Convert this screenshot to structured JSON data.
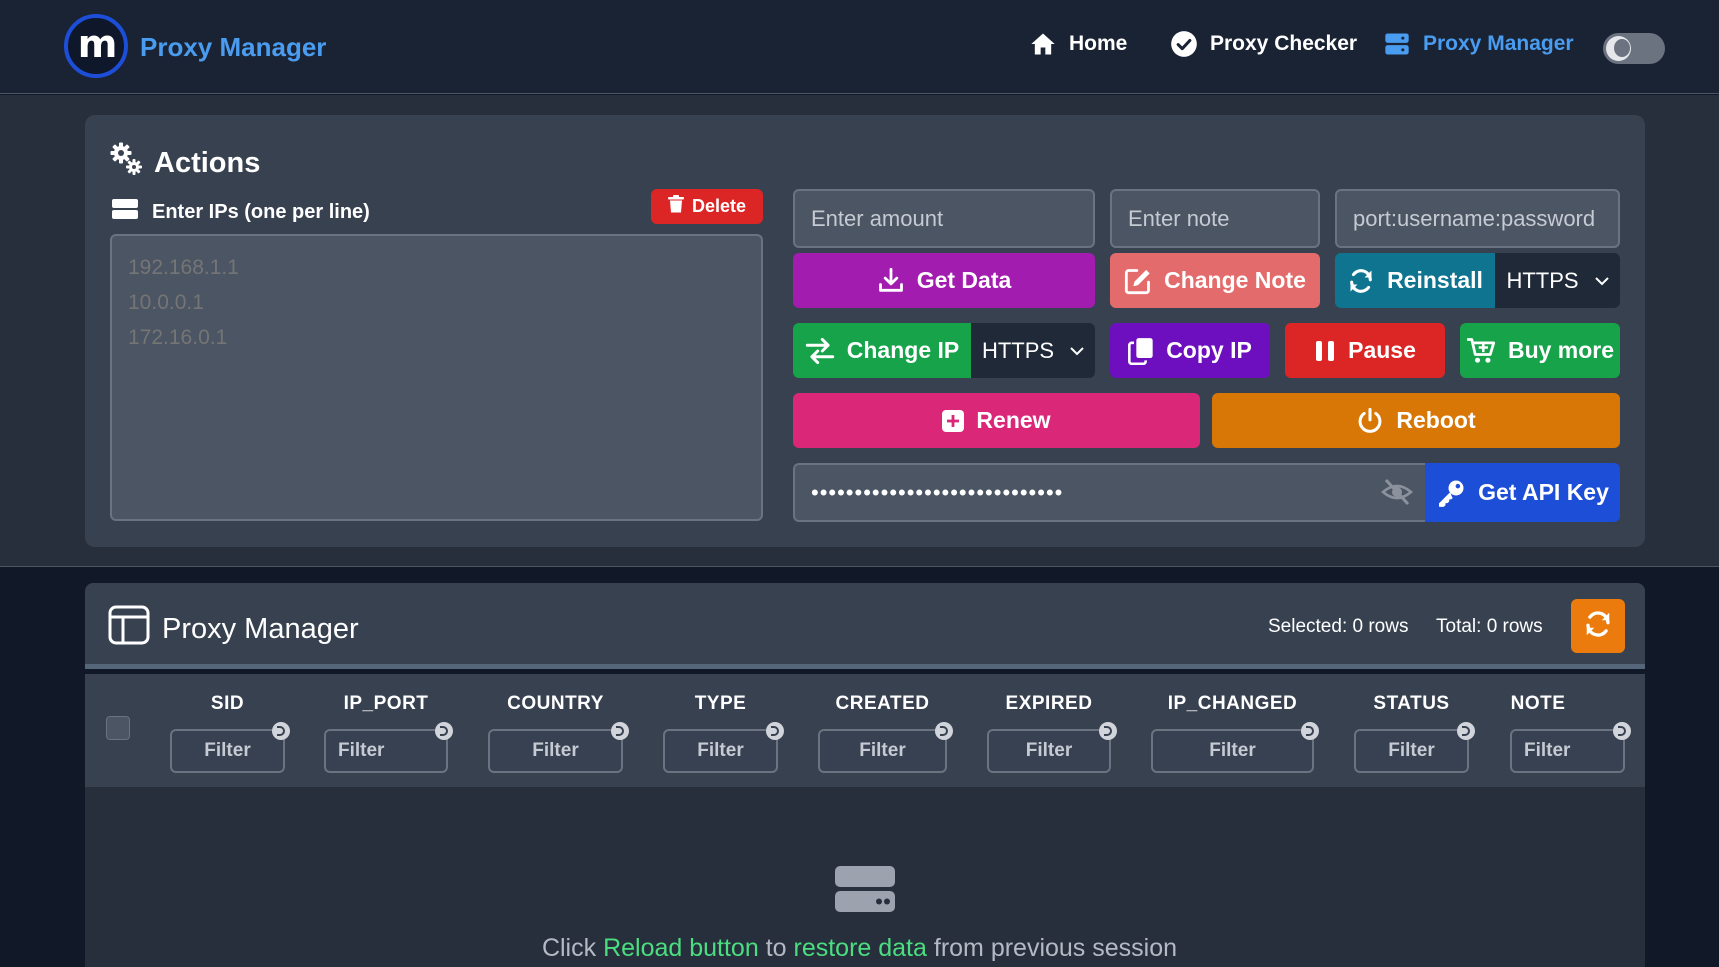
{
  "header": {
    "logo_text": "m",
    "brand": "Proxy Manager",
    "nav": [
      {
        "label": "Home",
        "icon": "home-icon"
      },
      {
        "label": "Proxy Checker",
        "icon": "check-circle-icon"
      },
      {
        "label": "Proxy Manager",
        "icon": "server-icon",
        "active": true
      }
    ],
    "theme_toggle": "dark"
  },
  "actions": {
    "title": "Actions",
    "ips_label": "Enter IPs (one per line)",
    "delete_label": "Delete",
    "ips_placeholder": "192.168.1.1\n10.0.0.1\n172.16.0.1",
    "amount_placeholder": "Enter amount",
    "note_placeholder": "Enter note",
    "port_placeholder": "port:username:password",
    "buttons": {
      "get_data": "Get Data",
      "change_note": "Change Note",
      "reinstall": "Reinstall",
      "reinstall_protocol": "HTTPS",
      "change_ip": "Change IP",
      "change_ip_protocol": "HTTPS",
      "copy_ip": "Copy IP",
      "pause": "Pause",
      "buy_more": "Buy more",
      "renew": "Renew",
      "reboot": "Reboot",
      "get_api_key": "Get API Key"
    },
    "api_key_masked": "•••••••••••••••••••••••••••••"
  },
  "proxy_manager": {
    "title": "Proxy Manager",
    "selected": "Selected: 0 rows",
    "total": "Total: 0 rows",
    "columns": [
      "SID",
      "IP_PORT",
      "COUNTRY",
      "TYPE",
      "CREATED",
      "EXPIRED",
      "IP_CHANGED",
      "STATUS",
      "NOTE"
    ],
    "filter_placeholder": "Filter",
    "empty": {
      "part1": "Click ",
      "reload": "Reload button",
      "part2": " to ",
      "restore": "restore data",
      "part3": " from previous session"
    }
  },
  "colors": {
    "accent": "#4a9cf0",
    "get_data": "#a21caf",
    "change_note": "#e36b6b",
    "reinstall": "#0e7490",
    "change_ip": "#16a34a",
    "copy_ip": "#6d0fbf",
    "pause": "#dc2626",
    "buy_more": "#16a34a",
    "renew": "#db2777",
    "reboot": "#d97706",
    "api_key": "#1d4ed8",
    "reload": "#ea7b0c",
    "highlight": "#4ade80"
  }
}
